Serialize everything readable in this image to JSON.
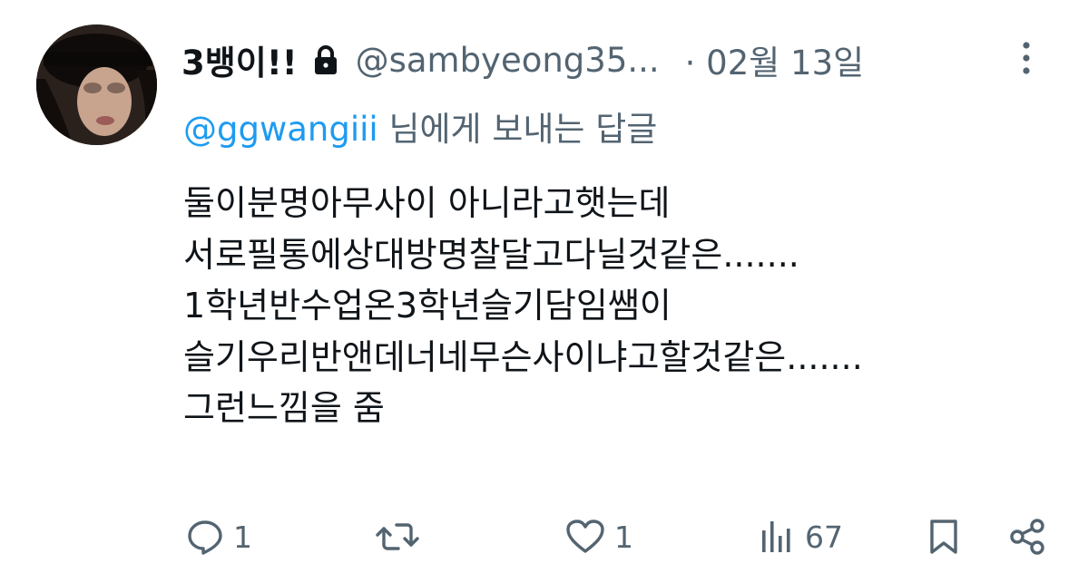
{
  "tweet": {
    "author": {
      "display_name": "3뱅이!!",
      "handle": "@sambyeong35...",
      "avatar_icon": "profile-photo",
      "protected_icon": "lock-icon"
    },
    "date": "· 02월 13일",
    "reply_to": {
      "mention": "@ggwangiii",
      "suffix": " 님에게 보내는 답글"
    },
    "text_lines": [
      "둘이분명아무사이  아니라고햇는데",
      "서로필통에상대방명찰달고다닐것같은.......",
      "1학년반수업온3학년슬기담임쌤이",
      "슬기우리반앤데너네무슨사이냐고할것같은.......",
      "그런느낌을 줌"
    ],
    "actions": {
      "reply_count": "1",
      "retweet_count": "",
      "like_count": "1",
      "view_count": "67"
    },
    "colors": {
      "text": "#0f1419",
      "secondary": "#536471",
      "link": "#1d9bf0"
    }
  }
}
